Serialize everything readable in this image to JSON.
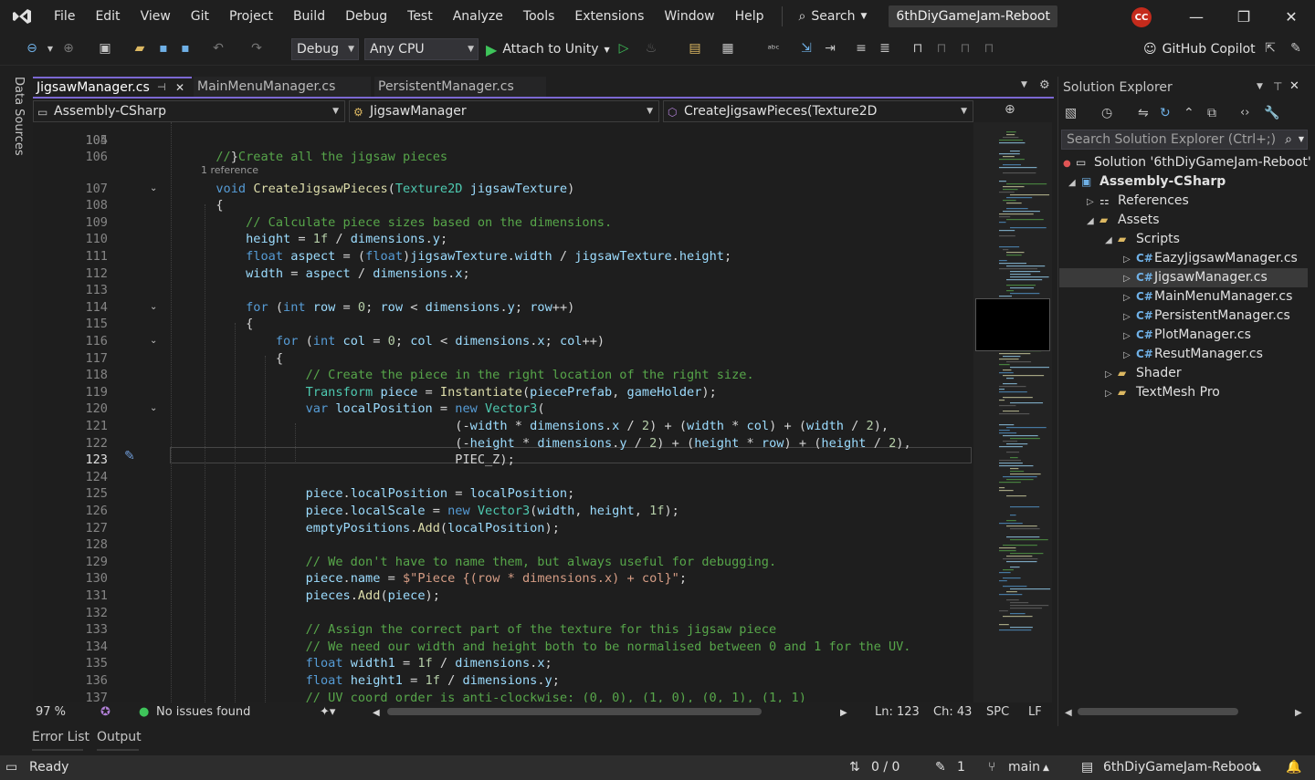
{
  "menubar": {
    "items": [
      "File",
      "Edit",
      "View",
      "Git",
      "Project",
      "Build",
      "Debug",
      "Test",
      "Analyze",
      "Tools",
      "Extensions",
      "Window",
      "Help"
    ],
    "search_label": "Search",
    "solution_title": "6thDiyGameJam-Reboot",
    "avatar_initials": "CC"
  },
  "toolbar": {
    "config": "Debug",
    "platform": "Any CPU",
    "attach_label": "Attach to Unity",
    "copilot_label": "GitHub Copilot"
  },
  "side_tab": "Data Sources",
  "tabs": [
    {
      "label": "JigsawManager.cs",
      "active": true
    },
    {
      "label": "MainMenuManager.cs",
      "active": false
    },
    {
      "label": "PersistentManager.cs",
      "active": false
    }
  ],
  "navbar": {
    "project": "Assembly-CSharp",
    "type": "JigsawManager",
    "member": "CreateJigsawPieces(Texture2D jigsawTexture)"
  },
  "editor": {
    "top_partial_number": "104",
    "top_partial_code": "    }",
    "codelens": "1 reference",
    "current_line": "123",
    "lines": [
      {
        "n": "105",
        "code": ""
      },
      {
        "n": "106",
        "code": "  // Create all the jigsaw pieces"
      },
      {
        "n": "107",
        "code": "  void CreateJigsawPieces(Texture2D jigsawTexture)"
      },
      {
        "n": "108",
        "code": "  {"
      },
      {
        "n": "109",
        "code": "      // Calculate piece sizes based on the dimensions."
      },
      {
        "n": "110",
        "code": "      height = 1f / dimensions.y;"
      },
      {
        "n": "111",
        "code": "      float aspect = (float)jigsawTexture.width / jigsawTexture.height;"
      },
      {
        "n": "112",
        "code": "      width = aspect / dimensions.x;"
      },
      {
        "n": "113",
        "code": ""
      },
      {
        "n": "114",
        "code": "      for (int row = 0; row < dimensions.y; row++)"
      },
      {
        "n": "115",
        "code": "      {"
      },
      {
        "n": "116",
        "code": "          for (int col = 0; col < dimensions.x; col++)"
      },
      {
        "n": "117",
        "code": "          {"
      },
      {
        "n": "118",
        "code": "              // Create the piece in the right location of the right size."
      },
      {
        "n": "119",
        "code": "              Transform piece = Instantiate(piecePrefab, gameHolder);"
      },
      {
        "n": "120",
        "code": "              var localPosition = new Vector3("
      },
      {
        "n": "121",
        "code": "                                  (-width * dimensions.x / 2) + (width * col) + (width / 2),"
      },
      {
        "n": "122",
        "code": "                                  (-height * dimensions.y / 2) + (height * row) + (height / 2),"
      },
      {
        "n": "123",
        "code": "                                  PIEC_Z);"
      },
      {
        "n": "124",
        "code": ""
      },
      {
        "n": "125",
        "code": "              piece.localPosition = localPosition;"
      },
      {
        "n": "126",
        "code": "              piece.localScale = new Vector3(width, height, 1f);"
      },
      {
        "n": "127",
        "code": "              emptyPositions.Add(localPosition);"
      },
      {
        "n": "128",
        "code": ""
      },
      {
        "n": "129",
        "code": "              // We don't have to name them, but always useful for debugging."
      },
      {
        "n": "130",
        "code": "              piece.name = $\"Piece {(row * dimensions.x) + col}\";"
      },
      {
        "n": "131",
        "code": "              pieces.Add(piece);"
      },
      {
        "n": "132",
        "code": ""
      },
      {
        "n": "133",
        "code": "              // Assign the correct part of the texture for this jigsaw piece"
      },
      {
        "n": "134",
        "code": "              // We need our width and height both to be normalised between 0 and 1 for the UV."
      },
      {
        "n": "135",
        "code": "              float width1 = 1f / dimensions.x;"
      },
      {
        "n": "136",
        "code": "              float height1 = 1f / dimensions.y;"
      },
      {
        "n": "137",
        "code": "              // UV coord order is anti-clockwise: (0, 0), (1, 0), (0, 1), (1, 1)"
      }
    ]
  },
  "editor_status": {
    "zoom": "97 %",
    "issues": "No issues found",
    "line": "Ln: 123",
    "col": "Ch: 43",
    "whitespace": "SPC",
    "eol": "LF"
  },
  "bottom_tabs": [
    "Error List",
    "Output"
  ],
  "statusbar": {
    "ready": "Ready",
    "changes": "0 / 0",
    "pending": "1",
    "branch": "main",
    "repo": "6thDiyGameJam-Reboot"
  },
  "solution_explorer": {
    "title": "Solution Explorer",
    "search_placeholder": "Search Solution Explorer (Ctrl+;)",
    "solution": "Solution '6thDiyGameJam-Reboot' (1",
    "project": "Assembly-CSharp",
    "references": "References",
    "assets": "Assets",
    "scripts": "Scripts",
    "files": [
      "EazyJigsawManager.cs",
      "JigsawManager.cs",
      "MainMenuManager.cs",
      "PersistentManager.cs",
      "PlotManager.cs",
      "ResutManager.cs"
    ],
    "shader": "Shader",
    "textmesh": "TextMesh Pro",
    "selected_file": "JigsawManager.cs"
  },
  "colors": {
    "accent": "#7c68d3",
    "keyword": "#569cd6",
    "type": "#4ec9b0",
    "comment": "#57a64a",
    "method": "#dcdcaa",
    "identifier": "#9cdcfe"
  }
}
